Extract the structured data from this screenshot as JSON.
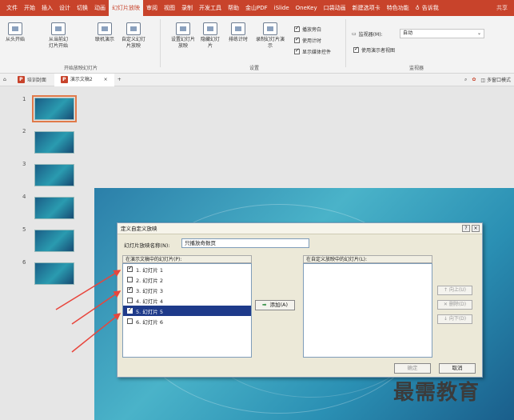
{
  "ribbon_tabs": [
    "文件",
    "开始",
    "插入",
    "设计",
    "切换",
    "动画",
    "幻灯片放映",
    "审阅",
    "视图",
    "录制",
    "开发工具",
    "帮助",
    "金山PDF",
    "iSlide",
    "OneKey",
    "口袋动画",
    "新建选项卡",
    "特色功能"
  ],
  "active_tab_index": 6,
  "tell_me": "告诉我",
  "share": "共享",
  "ribbon": {
    "start_from_beginning": "从头开始",
    "from_current": "从当前幻灯片开始",
    "present_online": "联机演示",
    "custom_show": "自定义幻灯片放映",
    "group_start": "开始放映幻灯片",
    "setup_show": "设置幻灯片放映",
    "hide_slide": "隐藏幻灯片",
    "rehearse": "排练计时",
    "record": "录制幻灯片演示",
    "play_narrations": "播放旁白",
    "use_timings": "使用计时",
    "show_media_controls": "显示媒体控件",
    "group_setup": "设置",
    "monitor_label": "监视器(M):",
    "monitor_value": "自动",
    "presenter_view": "使用演示者视图",
    "group_monitors": "监视器"
  },
  "docbar": {
    "tab1": "培训封面",
    "tab2": "演示文稿2",
    "close": "×",
    "new": "+",
    "right_label": "多窗口模式"
  },
  "slides": [
    {
      "num": "1",
      "selected": true
    },
    {
      "num": "2",
      "selected": false
    },
    {
      "num": "3",
      "selected": false
    },
    {
      "num": "4",
      "selected": false
    },
    {
      "num": "5",
      "selected": false
    },
    {
      "num": "6",
      "selected": false
    }
  ],
  "dialog": {
    "title": "定义自定义放映",
    "help": "?",
    "close": "×",
    "name_label": "幻灯片放映名称(N):",
    "name_value": "只播放奇数页",
    "left_list_label": "在演示文稿中的幻灯片(P):",
    "right_list_label": "在自定义放映中的幻灯片(L):",
    "items": [
      {
        "label": "1. 幻灯片 1",
        "checked": true,
        "selected": false
      },
      {
        "label": "2. 幻灯片 2",
        "checked": false,
        "selected": false
      },
      {
        "label": "3. 幻灯片 3",
        "checked": true,
        "selected": false
      },
      {
        "label": "4. 幻灯片 4",
        "checked": false,
        "selected": false
      },
      {
        "label": "5. 幻灯片 5",
        "checked": true,
        "selected": true
      },
      {
        "label": "6. 幻灯片 6",
        "checked": false,
        "selected": false
      }
    ],
    "add": "添加(A)",
    "move_up": "向上(U)",
    "delete": "删除(D)",
    "move_down": "向下(D)",
    "ok": "确定",
    "cancel": "取消"
  },
  "watermark": "最需教育",
  "colors": {
    "accent": "#c8432b",
    "selection": "#1e3a8a",
    "arrow": "#e8453c"
  }
}
